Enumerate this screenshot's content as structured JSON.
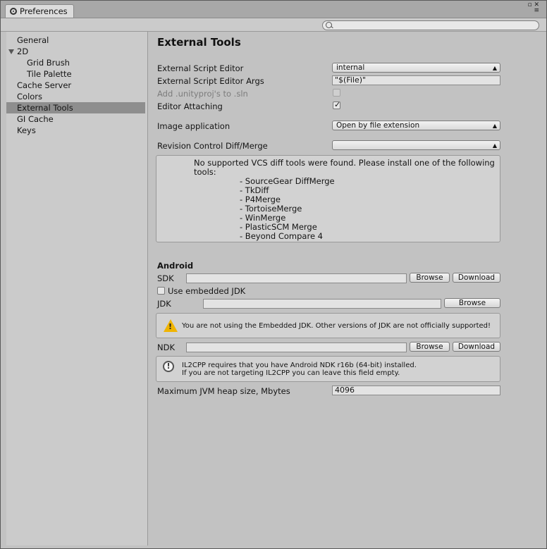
{
  "window": {
    "tab_title": "Preferences"
  },
  "search": {
    "placeholder": ""
  },
  "sidebar": {
    "items": [
      {
        "label": "General"
      },
      {
        "label": "2D"
      },
      {
        "label": "Grid Brush"
      },
      {
        "label": "Tile Palette"
      },
      {
        "label": "Cache Server"
      },
      {
        "label": "Colors"
      },
      {
        "label": "External Tools"
      },
      {
        "label": "GI Cache"
      },
      {
        "label": "Keys"
      }
    ],
    "selected": "External Tools"
  },
  "external_tools": {
    "title": "External Tools",
    "script_editor_label": "External Script Editor",
    "script_editor_value": "internal",
    "script_editor_args_label": "External Script Editor Args",
    "script_editor_args_value": "\"$(File)\"",
    "add_unityproj_label": "Add .unityproj's to .sln",
    "editor_attaching_label": "Editor Attaching",
    "editor_attaching_checked": true,
    "image_app_label": "Image application",
    "image_app_value": "Open by file extension",
    "revision_label": "Revision Control Diff/Merge",
    "revision_value": "",
    "vcs_message_line1": "No supported VCS diff tools were found. Please install one of the following",
    "vcs_message_line2": "tools:",
    "vcs_tools": [
      "- SourceGear DiffMerge",
      "- TkDiff",
      "- P4Merge",
      "- TortoiseMerge",
      "- WinMerge",
      "- PlasticSCM Merge",
      "- Beyond Compare 4"
    ]
  },
  "android": {
    "title": "Android",
    "sdk_label": "SDK",
    "sdk_value": "",
    "browse_label": "Browse",
    "download_label": "Download",
    "use_embedded_jdk_label": "Use embedded JDK",
    "use_embedded_jdk_checked": false,
    "jdk_label": "JDK",
    "jdk_value": "",
    "jdk_warning": "You are not using the Embedded JDK. Other versions of JDK are not officially supported!",
    "ndk_label": "NDK",
    "ndk_value": "",
    "ndk_info_line1": "IL2CPP requires that you have Android NDK r16b (64-bit) installed.",
    "ndk_info_line2": "If you are not targeting IL2CPP you can leave this field empty.",
    "jvm_heap_label": "Maximum JVM heap size, Mbytes",
    "jvm_heap_value": "4096"
  }
}
